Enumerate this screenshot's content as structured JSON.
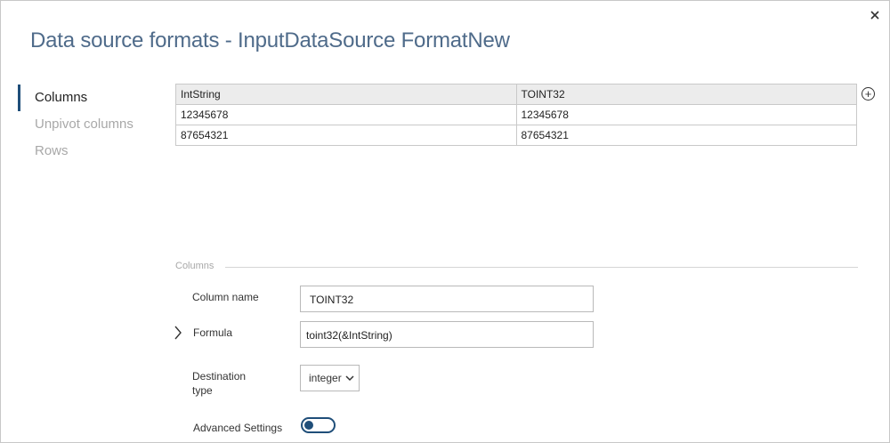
{
  "dialog": {
    "title": "Data source formats - InputDataSource FormatNew",
    "close_icon": "close-icon"
  },
  "nav": {
    "items": [
      {
        "label": "Columns",
        "active": true
      },
      {
        "label": "Unpivot columns",
        "active": false
      },
      {
        "label": "Rows",
        "active": false
      }
    ]
  },
  "grid": {
    "headers": [
      "IntString",
      "TOINT32"
    ],
    "rows": [
      [
        "12345678",
        "12345678"
      ],
      [
        "87654321",
        "87654321"
      ]
    ],
    "add_icon": "plus-circle-icon"
  },
  "details": {
    "section_label": "Columns",
    "column_name_label": "Column name",
    "column_name_value": "TOINT32",
    "formula_label": "Formula",
    "formula_value": "toint32(&IntString)",
    "destination_type_label_line1": "Destination",
    "destination_type_label_line2": "type",
    "destination_type_value": "integer",
    "advanced_settings_label": "Advanced Settings",
    "advanced_settings_on": false
  },
  "colors": {
    "title": "#4f6b8a",
    "accent": "#1f4e79",
    "muted": "#a8a8a8"
  }
}
